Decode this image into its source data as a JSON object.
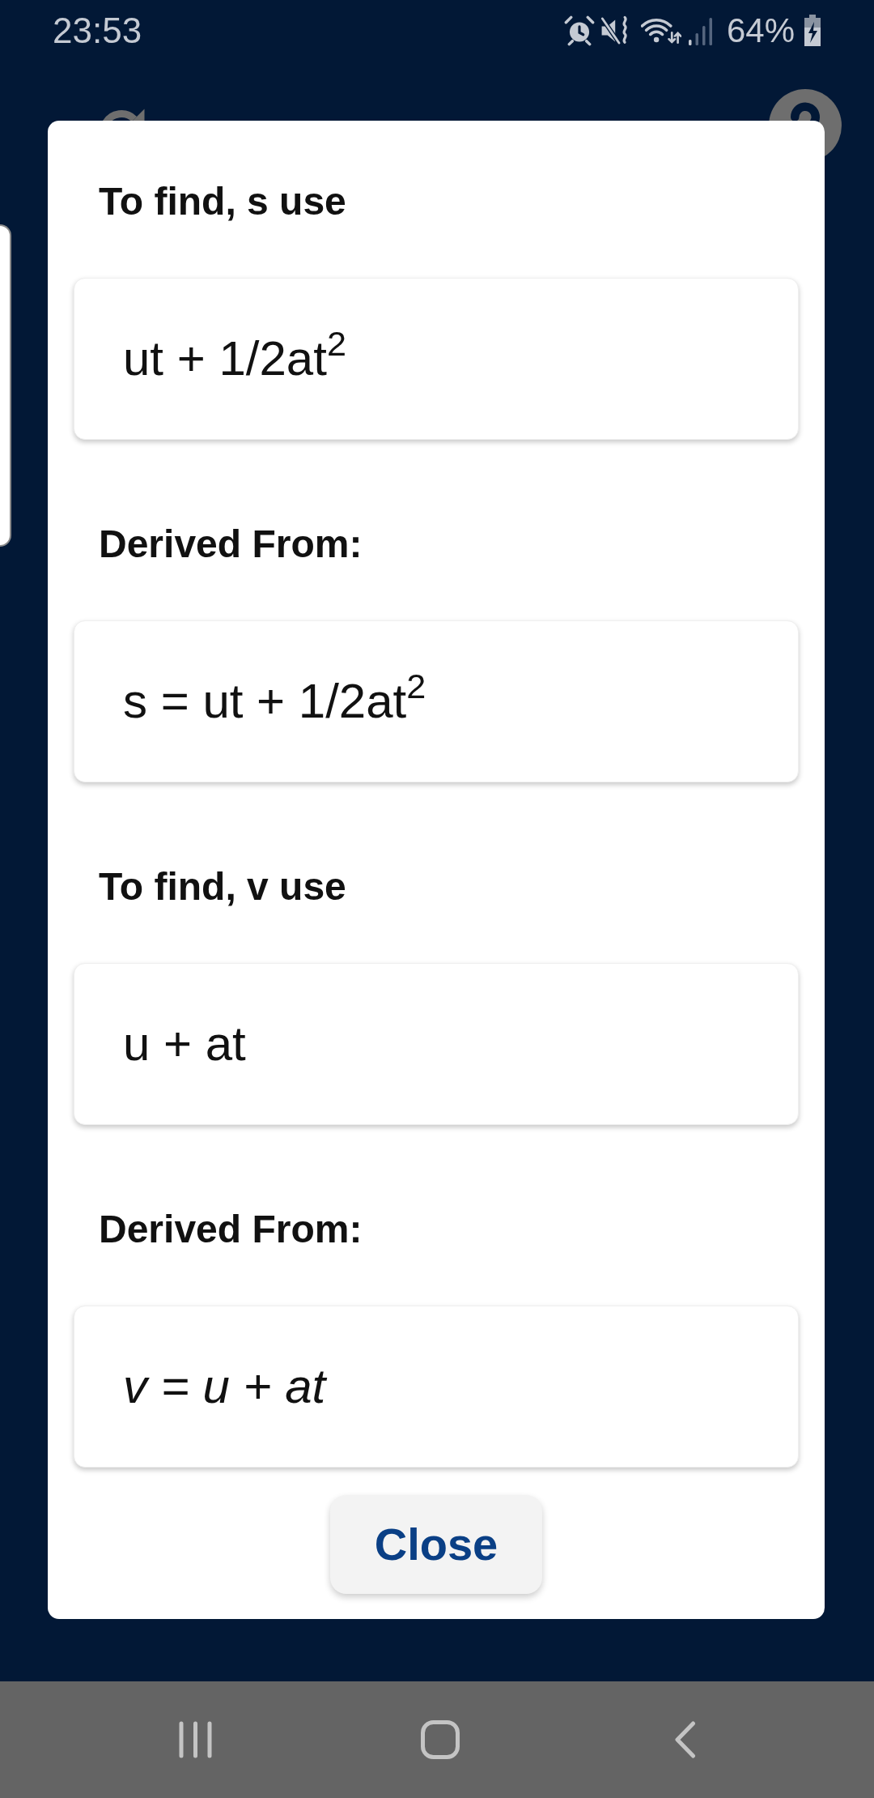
{
  "status_bar": {
    "time": "23:53",
    "battery": "64%"
  },
  "dialog": {
    "sections": [
      {
        "heading": "To find, s use",
        "formula": "ut + 1/2at$^{2}$",
        "italic": false
      },
      {
        "heading": "Derived From:",
        "formula": "s = ut + 1/2at$^{2}$",
        "italic": false
      },
      {
        "heading": "To find, v use",
        "formula": "u + at",
        "italic": false
      },
      {
        "heading": "Derived From:",
        "formula": "v = u + at",
        "italic": true
      }
    ],
    "close_button": "Close"
  }
}
